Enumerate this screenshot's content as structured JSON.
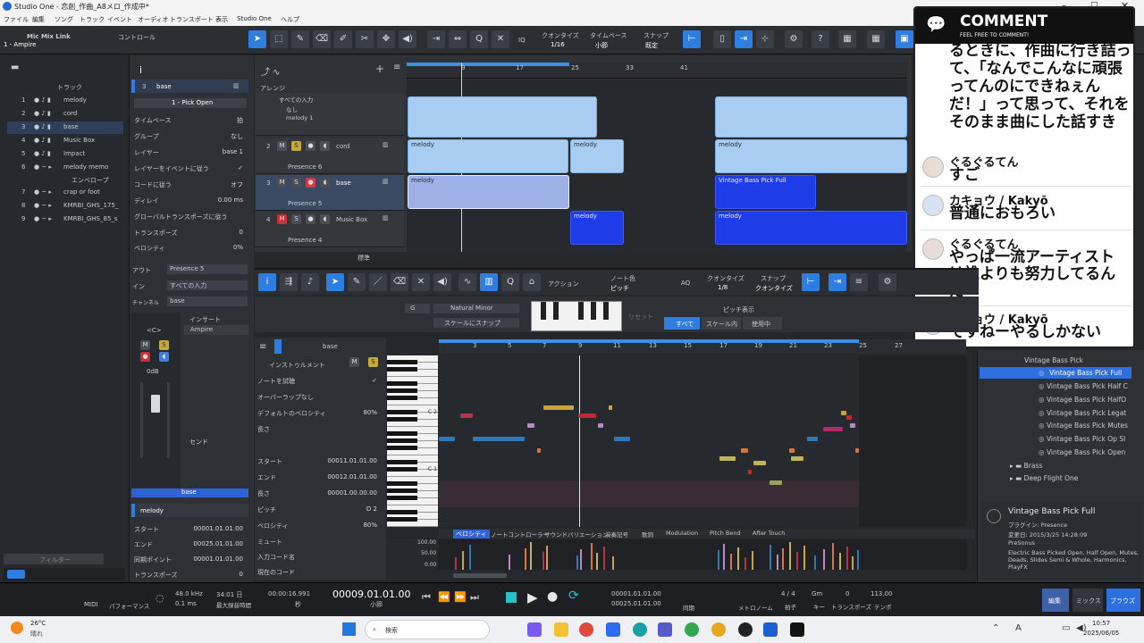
{
  "window": {
    "title": "Studio One - 恋創_作曲_A8メロ_作成中*"
  },
  "menu": [
    "ファイル",
    "編集",
    "ソング",
    "トラック",
    "イベント",
    "オーディオ",
    "トランスポート",
    "表示",
    "Studio One",
    "ヘルプ"
  ],
  "toolbar": {
    "mic_mix_link": "Mic Mix Link",
    "control": "コントロール",
    "input": "1 - Ampire",
    "quantize_label": "クオンタイズ",
    "quantize_value": "1/16",
    "timebase_label": "タイムベース",
    "timebase_value": "小節",
    "snap_label": "スナップ",
    "snap_value": "既定",
    "iq": "IQ"
  },
  "tracks_panel": {
    "header": "トラック",
    "tracks": [
      {
        "num": "1",
        "name": "melody"
      },
      {
        "num": "2",
        "name": "cord"
      },
      {
        "num": "3",
        "name": "base"
      },
      {
        "num": "4",
        "name": "Music Box"
      },
      {
        "num": "5",
        "name": "Impact"
      },
      {
        "num": "6",
        "name": "melody memo"
      },
      {
        "num": "",
        "name": "エンベロープ"
      },
      {
        "num": "7",
        "name": "crap or foot"
      },
      {
        "num": "8",
        "name": "KMRBI_GHS_175_"
      },
      {
        "num": "9",
        "name": "KMRBI_GHS_85_s"
      }
    ],
    "filter_placeholder": "フィルター"
  },
  "inspector": {
    "track_num": "3",
    "track_name": "base",
    "preset": "1 - Pick Open",
    "rows": [
      {
        "k": "タイムベース",
        "v": "拍"
      },
      {
        "k": "グループ",
        "v": "なし"
      },
      {
        "k": "レイヤー",
        "v": "base 1"
      },
      {
        "k": "レイヤーをイベントに従う",
        "v": "✓"
      },
      {
        "k": "コードに従う",
        "v": "オフ"
      },
      {
        "k": "ディレイ",
        "v": "0.00 ms"
      },
      {
        "k": "グローバルトランスポーズに従う",
        "v": ""
      },
      {
        "k": "トランスポーズ",
        "v": "0"
      },
      {
        "k": "ベロシティ",
        "v": "0%"
      }
    ],
    "out_label": "アウト",
    "out_value": "Presence 5",
    "in_label": "イン",
    "in_value": "すべての入力",
    "ch_label": "チャンネル",
    "ch_value": "base",
    "insert_label": "インサート",
    "insert_item": "Ampire",
    "send_label": "センド",
    "pan": "<C>",
    "volume": "0dB",
    "channel_name": "base",
    "event_name": "melody",
    "event_rows": [
      {
        "k": "スタート",
        "v": "00001.01.01.00"
      },
      {
        "k": "エンド",
        "v": "00025.01.01.00"
      },
      {
        "k": "同期ポイント",
        "v": "00001.01.01.00"
      },
      {
        "k": "トランスポーズ",
        "v": "0"
      }
    ]
  },
  "arrange": {
    "header": "アレンジ",
    "ruler": [
      "9",
      "17",
      "25",
      "33",
      "41"
    ],
    "track_heads": [
      {
        "num": "2",
        "name": "cord",
        "out": "Presence 6"
      },
      {
        "num": "3",
        "name": "base",
        "out": "Presence 5"
      },
      {
        "num": "4",
        "name": "Music Box",
        "out": "Presence 4"
      }
    ],
    "top_head_lines": [
      "すべての入力",
      "なし",
      "melody 1"
    ],
    "clips": [
      {
        "name": "melody"
      },
      {
        "name": "melody"
      },
      {
        "name": "melody"
      },
      {
        "name": "melody"
      },
      {
        "name": "Vintage Bass Pick Full"
      },
      {
        "name": "melody"
      },
      {
        "name": "melody"
      }
    ],
    "footer_label": "標準"
  },
  "comments": {
    "title": "COMMENT",
    "subtitle": "FEEL FREE TO COMMENT!",
    "partial": "るときに、作曲に行き詰って、「なんでこんなに頑張ってんのにできねぇんだ！」って思って、それをそのまま曲にした話すき",
    "items": [
      {
        "name": "ぐるぐるてん",
        "body": "すご"
      },
      {
        "name": "カキョウ / Kakyō",
        "body": "普通におもろい"
      },
      {
        "name": "ぐるぐるてん",
        "body": "やっぱ一流アーティストは誰よりも努力してるんだ"
      },
      {
        "name": "カキョウ / Kakyō",
        "body": "ですねーやるしかない"
      }
    ]
  },
  "editor_toolbar": {
    "action": "アクション",
    "note_color_label": "ノート色",
    "note_color_value": "ピッチ",
    "aq": "AQ",
    "quantize_label": "クオンタイズ",
    "quantize_value": "1/8",
    "snap_label": "スナップ",
    "snap_value": "クオンタイズ",
    "key": "G",
    "scale": "Natural Minor",
    "scale_snap": "スケールにスナップ",
    "reset": "リセット",
    "pitch_display": "ピッチ表示",
    "all": "すべて",
    "in_scale": "スケール内",
    "used": "使用中"
  },
  "editor": {
    "track_name": "base",
    "instrument": "インストゥルメント",
    "rows": [
      {
        "k": "ノートを試聴",
        "v": "✓"
      },
      {
        "k": "オーバーラップなし",
        "v": ""
      },
      {
        "k": "デフォルトのベロシティ",
        "v": "80%"
      },
      {
        "k": "長さ",
        "v": ""
      }
    ],
    "note_rows": [
      {
        "k": "スタート",
        "v": "00011.01.01.00"
      },
      {
        "k": "エンド",
        "v": "00012.01.01.00"
      },
      {
        "k": "長さ",
        "v": "00001.00.00.00"
      },
      {
        "k": "ピッチ",
        "v": "D 2"
      },
      {
        "k": "ベロシティ",
        "v": "80%"
      },
      {
        "k": "ミュート",
        "v": ""
      },
      {
        "k": "入力コード名",
        "v": ""
      },
      {
        "k": "現在のコード",
        "v": ""
      }
    ],
    "ruler": [
      "3",
      "5",
      "7",
      "9",
      "11",
      "13",
      "15",
      "17",
      "19",
      "21",
      "23",
      "25",
      "27"
    ],
    "key_labels": [
      "C 2",
      "C 1"
    ],
    "lane_tabs": [
      "ベロシティ",
      "ノートコントローラー",
      "サウンドバリエーション",
      "演奏記号",
      "歌詞",
      "Modulation",
      "Pitch Bend",
      "After Touch"
    ],
    "vel_scale": [
      "100.00",
      "50.00",
      "0.00"
    ]
  },
  "browser": {
    "folder": "Vintage Bass Pick",
    "items": [
      "Vintage Bass Pick Full",
      "Vintage Bass Pick Half C",
      "Vintage Bass Pick HalfO",
      "Vintage Bass Pick Legat",
      "Vintage Bass Pick Mutes",
      "Vintage Bass Pick Op Sl",
      "Vintage Bass Pick Open"
    ],
    "folders": [
      "Brass",
      "Deep Flight One"
    ],
    "info_title": "Vintage Bass Pick Full",
    "info_plugin": "プラグイン: Presence",
    "info_date": "変更日: 2015/3/25 14:28:09",
    "info_vendor": "PreSonus",
    "info_desc": "Electric Bass Picked Open, Half Open, Mutes, Deads, Slides Semi & Whole, Harmonics, PlayFX",
    "tabs": [
      "編集",
      "ミックス",
      "ブラウズ"
    ]
  },
  "transport": {
    "midi": "MIDI",
    "performance": "パフォーマンス",
    "samplerate": "48.0 kHz",
    "latency": "0.1 ms",
    "rec_time": "34:01 日",
    "rec_time_label": "最大録音時間",
    "time_sec": "00:00:16.991",
    "time_sec_label": "秒",
    "position": "00009.01.01.00",
    "position_label": "小節",
    "loop_l": "00001.01.01.00",
    "loop_r": "00025.01.01.00",
    "sync": "同期",
    "metronome": "メトロノーム",
    "meter": "4 / 4",
    "meter_label": "拍子",
    "key": "Gm",
    "key_label": "キー",
    "transpose": "0",
    "transpose_label": "トランスポーズ",
    "tempo": "113.00",
    "tempo_label": "テンポ"
  },
  "taskbar": {
    "weather_temp": "26°C",
    "weather_desc": "晴れ",
    "search": "検索",
    "time": "10:57",
    "date": "2025/06/05"
  }
}
